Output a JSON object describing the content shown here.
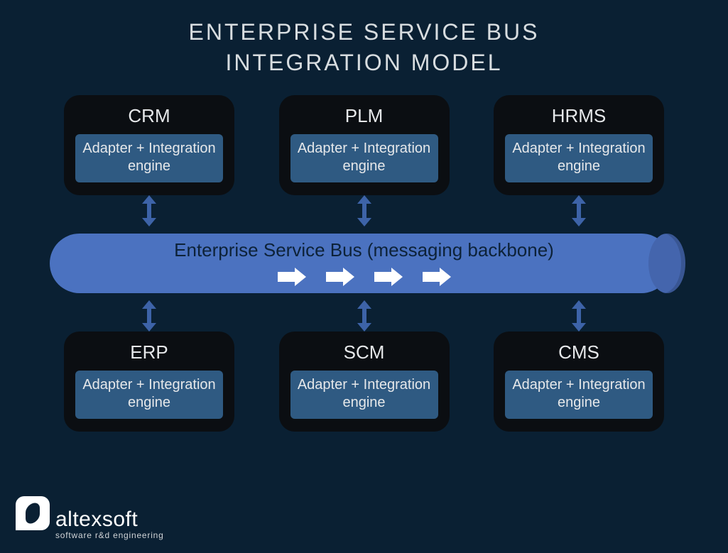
{
  "title_line1": "ENTERPRISE SERVICE BUS",
  "title_line2": "INTEGRATION MODEL",
  "adapter_label": "Adapter + Integration engine",
  "bus_label": "Enterprise Service Bus (messaging backbone)",
  "top_nodes": [
    {
      "name": "CRM"
    },
    {
      "name": "PLM"
    },
    {
      "name": "HRMS"
    }
  ],
  "bottom_nodes": [
    {
      "name": "ERP"
    },
    {
      "name": "SCM"
    },
    {
      "name": "CMS"
    }
  ],
  "brand": {
    "name": "altexsoft",
    "tagline": "software r&d engineering"
  }
}
